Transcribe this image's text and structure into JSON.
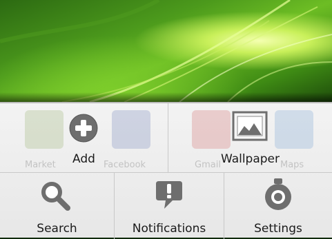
{
  "background_apps": [
    "Market",
    "Facebook",
    "Gmail",
    "Maps"
  ],
  "menu": {
    "items": [
      {
        "label": "Add",
        "icon": "add-circle-icon"
      },
      {
        "label": "Wallpaper",
        "icon": "picture-icon"
      },
      {
        "label": "Search",
        "icon": "search-icon"
      },
      {
        "label": "Notifications",
        "icon": "notification-alert-icon"
      },
      {
        "label": "Settings",
        "icon": "settings-icon"
      }
    ]
  },
  "colors": {
    "icon_gray": "#6e6e6e",
    "wallpaper_green": "#6dbd24",
    "menu_bg": "#eeeeee"
  }
}
